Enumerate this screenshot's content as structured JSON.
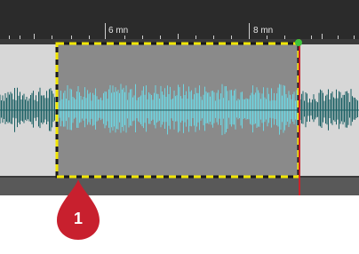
{
  "ruler": {
    "labels": [
      "6 mn",
      "8 mn"
    ]
  },
  "selection": {
    "border_colors": [
      "#f2e600",
      "#1a1a1a"
    ]
  },
  "marker": {
    "number": "1",
    "color": "#c8202e"
  },
  "colors": {
    "waveform": "#1a5f63",
    "selected_waveform": "#6fd6e2",
    "playhead": "#c8242c",
    "playhead_dot": "#3fc43c"
  }
}
